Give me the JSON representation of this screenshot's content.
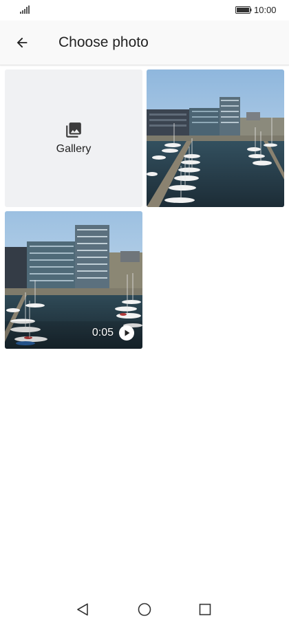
{
  "status_bar": {
    "time": "10:00",
    "signal_icon": "signal-icon",
    "battery_icon": "battery-icon"
  },
  "app_bar": {
    "back_icon": "arrow-back-icon",
    "title": "Choose photo"
  },
  "grid": {
    "gallery": {
      "icon": "photo-library-icon",
      "label": "Gallery"
    },
    "items": [
      {
        "type": "photo",
        "subject": "harbour-marina-photo"
      },
      {
        "type": "video",
        "duration": "0:05",
        "icon": "play-icon"
      }
    ]
  },
  "nav_bar": {
    "back_icon": "nav-back-icon",
    "home_icon": "nav-home-icon",
    "recent_icon": "nav-recent-apps-icon"
  },
  "colors": {
    "app_bar_bg": "#f9f9f9",
    "gallery_tile_bg": "#f0f1f3",
    "text": "#222222"
  }
}
